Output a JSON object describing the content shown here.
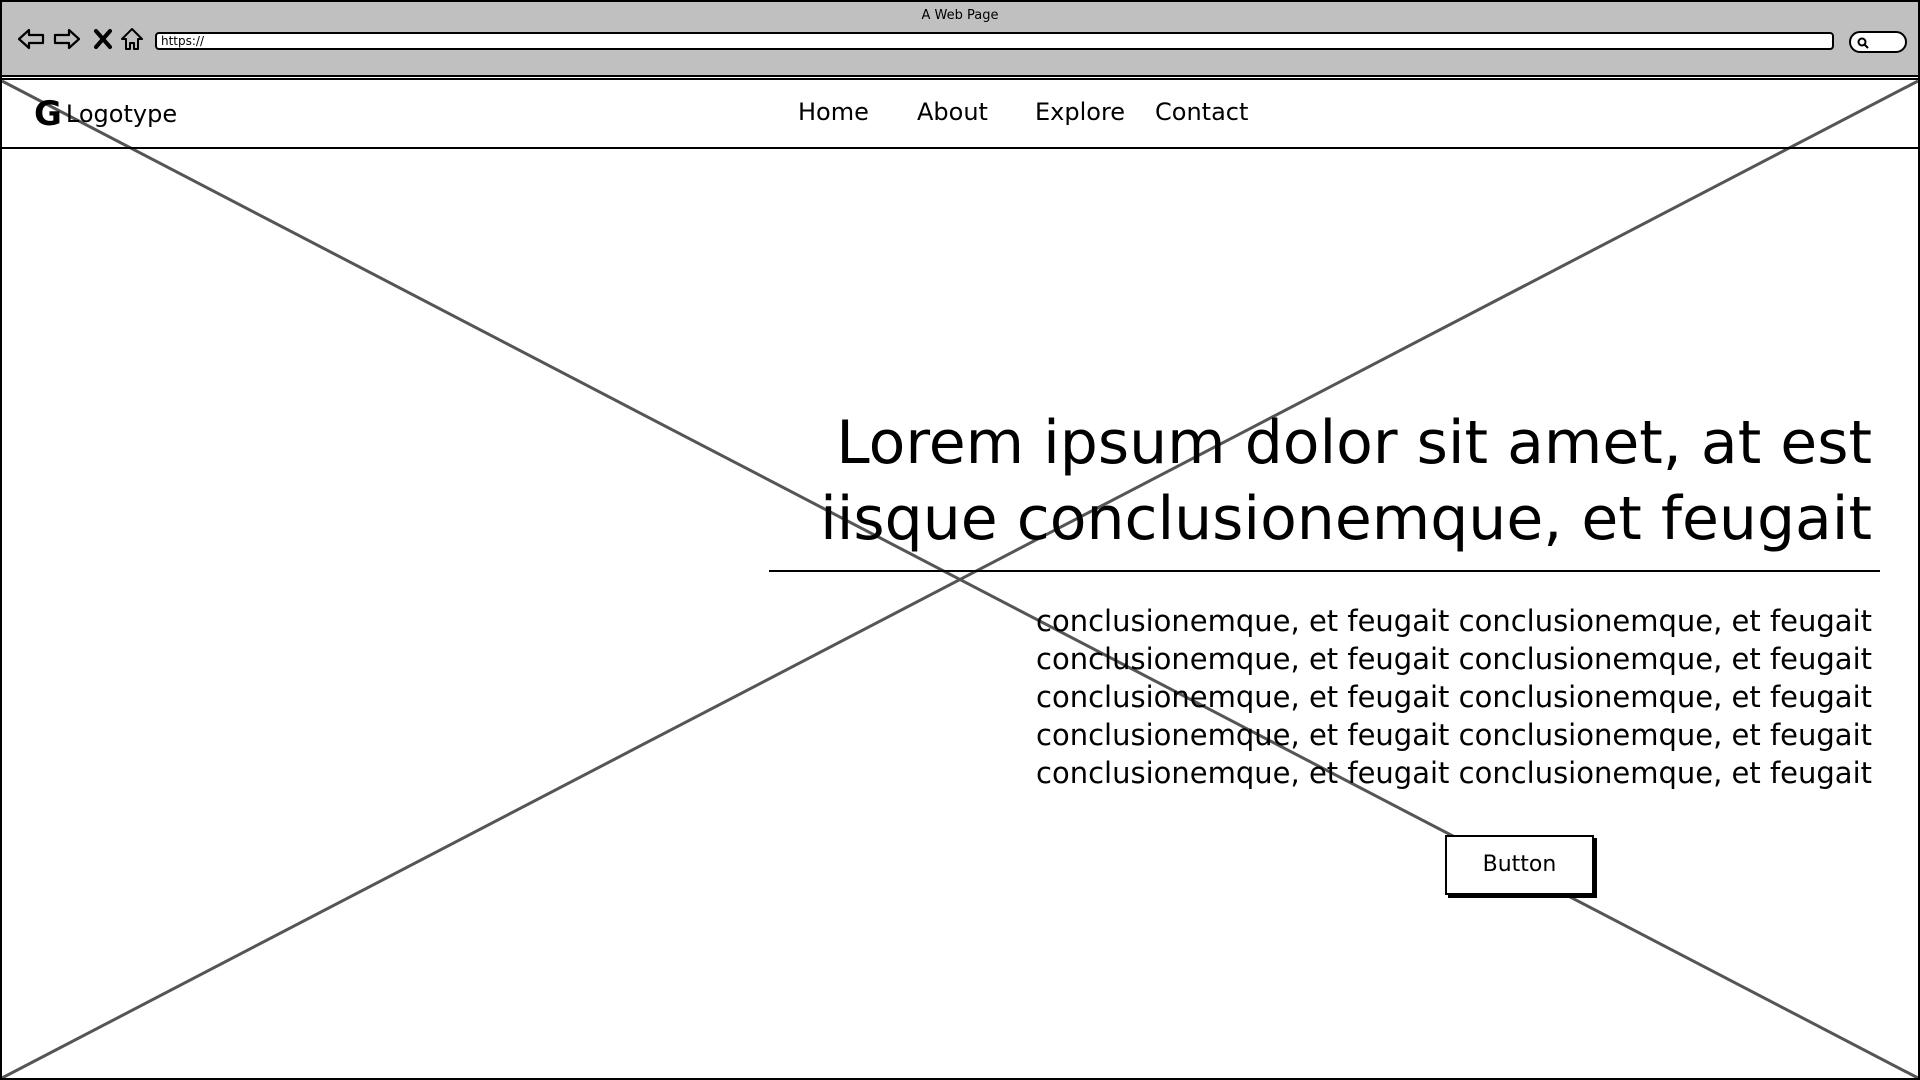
{
  "window": {
    "title": "A Web Page"
  },
  "browser": {
    "url": "https://",
    "icons": [
      "back-arrow-icon",
      "forward-arrow-icon",
      "close-icon",
      "home-icon",
      "search-icon"
    ]
  },
  "site": {
    "logo_mark": "G",
    "logo_text": "Logotype",
    "nav": [
      "Home",
      "About",
      "Explore",
      "Contact"
    ]
  },
  "hero": {
    "heading": "Lorem ipsum dolor sit amet, at est iisque conclusionemque, et feugait",
    "body": "conclusionemque, et feugait conclusionemque, et feugait conclusionemque, et feugait conclusionemque, et feugait conclusionemque, et feugait conclusionemque, et feugait conclusionemque, et feugait conclusionemque, et feugait conclusionemque, et feugait conclusionemque, et feugait",
    "button_label": "Button"
  }
}
